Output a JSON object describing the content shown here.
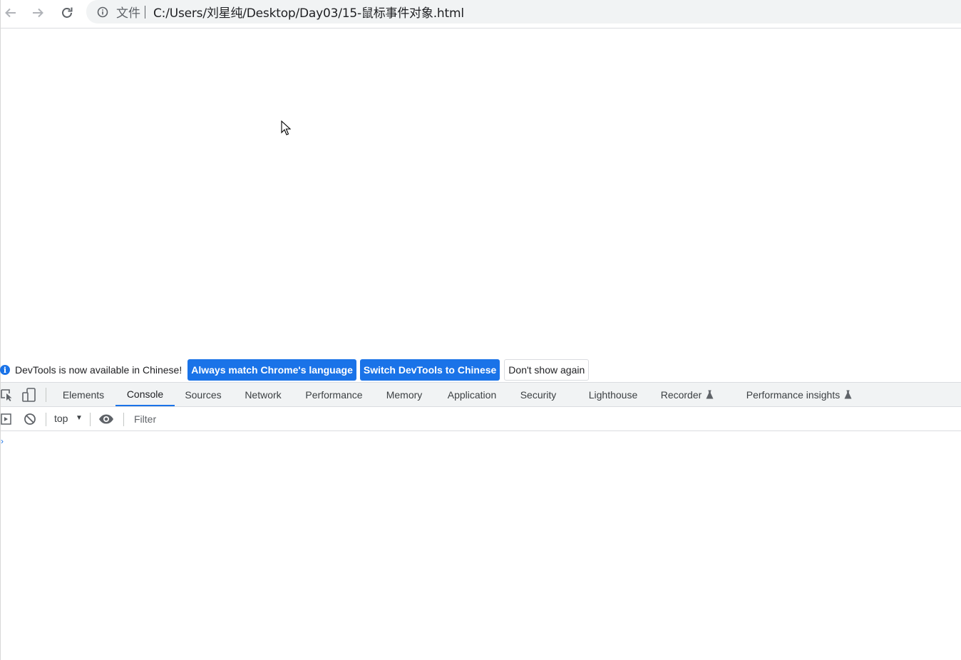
{
  "browser": {
    "scheme_label": "文件",
    "url": "C:/Users/刘星纯/Desktop/Day03/15-鼠标事件对象.html"
  },
  "infobar": {
    "message": "DevTools is now available in Chinese!",
    "btn_match": "Always match Chrome's language",
    "btn_switch": "Switch DevTools to Chinese",
    "btn_dismiss": "Don't show again"
  },
  "devtools": {
    "tabs": [
      {
        "label": "Elements"
      },
      {
        "label": "Console"
      },
      {
        "label": "Sources"
      },
      {
        "label": "Network"
      },
      {
        "label": "Performance"
      },
      {
        "label": "Memory"
      },
      {
        "label": "Application"
      },
      {
        "label": "Security"
      },
      {
        "label": "Lighthouse"
      },
      {
        "label": "Recorder"
      },
      {
        "label": "Performance insights"
      }
    ],
    "active_tab": "Console",
    "console": {
      "context": "top",
      "filter_placeholder": "Filter"
    }
  },
  "colors": {
    "accent": "#1a73e8",
    "toolbar_bg": "#f1f3f4"
  }
}
